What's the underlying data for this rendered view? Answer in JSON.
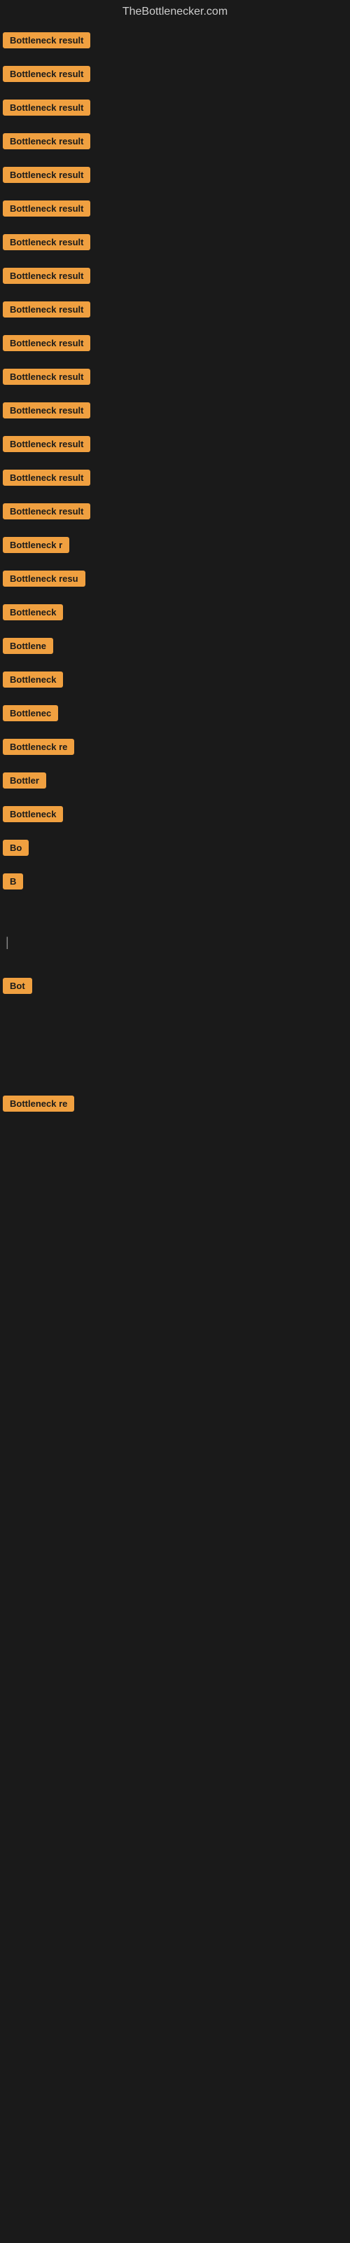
{
  "site": {
    "title": "TheBottlenecker.com"
  },
  "results": [
    {
      "label": "Bottleneck result",
      "width": 120
    },
    {
      "label": "Bottleneck result",
      "width": 118
    },
    {
      "label": "Bottleneck result",
      "width": 119
    },
    {
      "label": "Bottleneck result",
      "width": 117
    },
    {
      "label": "Bottleneck result",
      "width": 118
    },
    {
      "label": "Bottleneck result",
      "width": 119
    },
    {
      "label": "Bottleneck result",
      "width": 118
    },
    {
      "label": "Bottleneck result",
      "width": 117
    },
    {
      "label": "Bottleneck result",
      "width": 119
    },
    {
      "label": "Bottleneck result",
      "width": 118
    },
    {
      "label": "Bottleneck result",
      "width": 119
    },
    {
      "label": "Bottleneck result",
      "width": 118
    },
    {
      "label": "Bottleneck result",
      "width": 117
    },
    {
      "label": "Bottleneck result",
      "width": 119
    },
    {
      "label": "Bottleneck result",
      "width": 116
    },
    {
      "label": "Bottleneck r",
      "width": 95
    },
    {
      "label": "Bottleneck resu",
      "width": 100
    },
    {
      "label": "Bottleneck",
      "width": 80
    },
    {
      "label": "Bottlene",
      "width": 70
    },
    {
      "label": "Bottleneck",
      "width": 78
    },
    {
      "label": "Bottlenec",
      "width": 72
    },
    {
      "label": "Bottleneck re",
      "width": 90
    },
    {
      "label": "Bottler",
      "width": 60
    },
    {
      "label": "Bottleneck",
      "width": 75
    },
    {
      "label": "Bo",
      "width": 30
    },
    {
      "label": "B",
      "width": 14
    },
    {
      "label": "",
      "width": 0
    },
    {
      "label": "",
      "width": 0
    },
    {
      "label": "|",
      "width": 8
    },
    {
      "label": "",
      "width": 0
    },
    {
      "label": "Bot",
      "width": 28
    },
    {
      "label": "",
      "width": 0
    },
    {
      "label": "",
      "width": 0
    },
    {
      "label": "",
      "width": 0
    },
    {
      "label": "",
      "width": 0
    },
    {
      "label": "",
      "width": 0
    },
    {
      "label": "",
      "width": 0
    },
    {
      "label": "Bottleneck re",
      "width": 90
    },
    {
      "label": "",
      "width": 0
    },
    {
      "label": "",
      "width": 0
    },
    {
      "label": "",
      "width": 0
    },
    {
      "label": "",
      "width": 0
    },
    {
      "label": "",
      "width": 0
    },
    {
      "label": "",
      "width": 0
    }
  ]
}
